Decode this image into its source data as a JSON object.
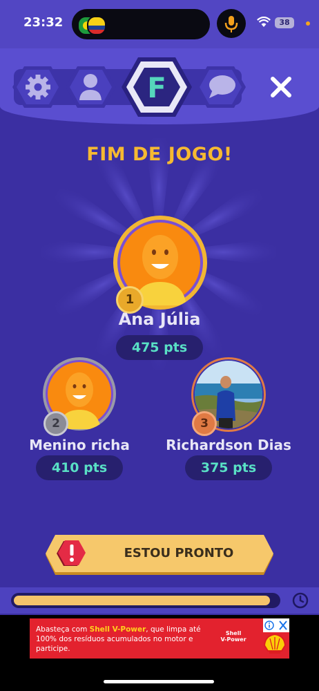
{
  "status_bar": {
    "time": "23:32",
    "battery": "38"
  },
  "header": {
    "tabs": [
      {
        "icon": "gear-icon",
        "active": false
      },
      {
        "icon": "profile-icon",
        "active": false
      },
      {
        "icon": "letter-f-icon",
        "letter": "F",
        "active": true
      },
      {
        "icon": "chat-icon",
        "active": false
      }
    ],
    "close_icon": "close-icon"
  },
  "main": {
    "title": "FIM DE JOGO!",
    "players": [
      {
        "rank": "1",
        "name": "Ana Júlia",
        "points": "475 pts"
      },
      {
        "rank": "2",
        "name": "Menino richa",
        "points": "410 pts"
      },
      {
        "rank": "3",
        "name": "Richardson Dias",
        "points": "375 pts"
      }
    ],
    "ready_button": {
      "label": "ESTOU PRONTO",
      "icon": "alert-icon"
    },
    "timer": {
      "progress": 0.97,
      "icon": "clock-icon"
    }
  },
  "ad": {
    "text_pre": "Abasteça com ",
    "text_brand": "Shell V-Power",
    "text_post": ", que limpa até 100% dos resíduos acumulados no motor e participe.",
    "brand_line1": "Shell",
    "brand_line2": "V-Power"
  },
  "colors": {
    "background": "#3b2fa2",
    "header": "#5a4ed0",
    "title": "#f6b931",
    "gold": "#f2b632",
    "silver": "#9a9aa6",
    "bronze": "#e07a44",
    "points_text": "#59e0c5",
    "ad_red": "#e3222e"
  }
}
